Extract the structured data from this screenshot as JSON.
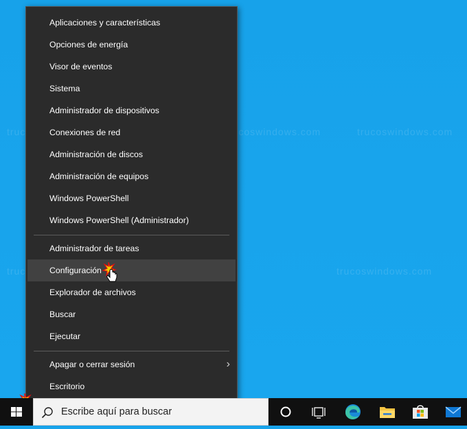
{
  "watermark_text": "trucoswindows.com",
  "menu": {
    "group1": [
      "Aplicaciones y características",
      "Opciones de energía",
      "Visor de eventos",
      "Sistema",
      "Administrador de dispositivos",
      "Conexiones de red",
      "Administración de discos",
      "Administración de equipos",
      "Windows PowerShell",
      "Windows PowerShell (Administrador)"
    ],
    "group2": [
      "Administrador de tareas",
      "Configuración",
      "Explorador de archivos",
      "Buscar",
      "Ejecutar"
    ],
    "group3": [
      "Apagar o cerrar sesión",
      "Escritorio"
    ],
    "highlighted_item": "Configuración"
  },
  "taskbar": {
    "search_placeholder": "Escribe aquí para buscar",
    "icons": [
      "windows-start-icon",
      "search-icon",
      "cortana-icon",
      "task-view-icon",
      "edge-icon",
      "file-explorer-icon",
      "store-icon",
      "mail-icon"
    ]
  },
  "colors": {
    "desktop": "#18a3ea",
    "menu_bg": "#2b2b2b",
    "menu_hover": "#414141",
    "taskbar": "#101010"
  }
}
